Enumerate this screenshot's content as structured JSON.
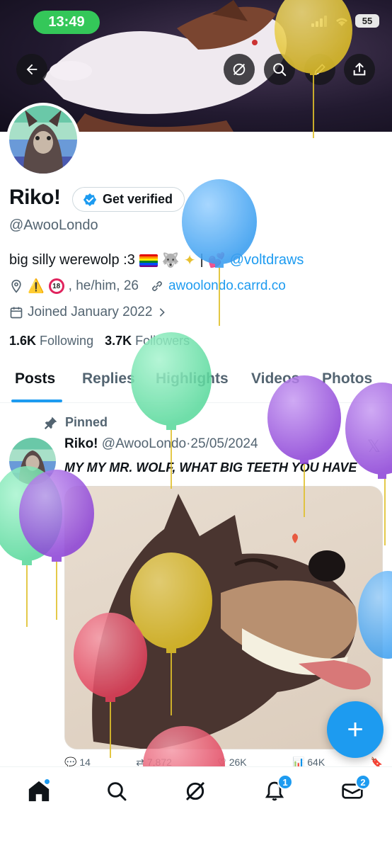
{
  "status_bar": {
    "time": "13:49",
    "battery": "55"
  },
  "profile": {
    "name": "Riko!",
    "get_verified_label": "Get verified",
    "handle": "@AwooLondo",
    "bio_text": "big silly werewolp :3",
    "bio_link": "@voltdraws",
    "location_text": ", he/him, 26",
    "website": "awoolondo.carrd.co",
    "joined": "Joined January 2022",
    "following_count": "1.6K",
    "following_label": "Following",
    "followers_count": "3.7K",
    "followers_label": "Followers"
  },
  "tabs": [
    {
      "label": "Posts",
      "active": true
    },
    {
      "label": "Replies",
      "active": false
    },
    {
      "label": "Highlights",
      "active": false
    },
    {
      "label": "Videos",
      "active": false
    },
    {
      "label": "Photos",
      "active": false
    }
  ],
  "post": {
    "pinned_label": "Pinned",
    "author_name": "Riko!",
    "author_handle": "@AwooLondo",
    "date": "25/05/2024",
    "separator": "·",
    "text": "MY MY MR. WOLF, WHAT BIG TEETH YOU HAVE",
    "x_logo": "𝕏",
    "actions": {
      "replies": "14",
      "reposts": "7,872",
      "likes": "26K",
      "views": "64K"
    }
  },
  "fab_label": "+",
  "bottom_nav": {
    "items": [
      "home-icon",
      "search-icon",
      "grok-icon",
      "notifications-icon",
      "messages-icon"
    ],
    "notifications_badge": "1",
    "messages_badge": "2"
  },
  "colors": {
    "accent": "#1d9bf0",
    "status_green": "#34c759"
  }
}
